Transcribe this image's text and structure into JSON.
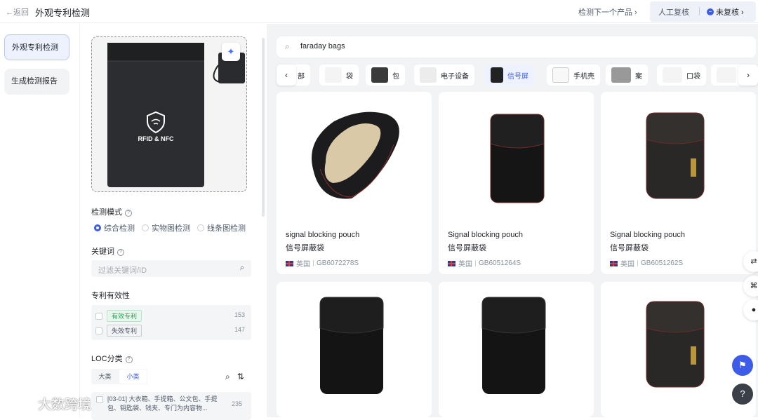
{
  "header": {
    "back_label": "←返回",
    "title": "外观专利检测",
    "next_product": "检测下一个产品 ›",
    "manual_review": "人工复核",
    "unreviewed": "未复核 ›"
  },
  "sidebar": {
    "items": [
      {
        "label": "外观专利检测",
        "active": true
      },
      {
        "label": "生成检测报告",
        "active": false
      }
    ]
  },
  "panel": {
    "image_text": "RFID & NFC",
    "mode_label": "检测模式",
    "modes": [
      "综合检测",
      "实物图检测",
      "线条图检测"
    ],
    "selected_mode": "综合检测",
    "keyword_label": "关键词",
    "keyword_placeholder": "过滤关键词/ID",
    "validity_label": "专利有效性",
    "validity": [
      {
        "label": "有效专利",
        "count": "153"
      },
      {
        "label": "失效专利",
        "count": "147"
      }
    ],
    "loc_label": "LOC分类",
    "loc_tabs": [
      "大类",
      "小类"
    ],
    "loc_selected_tab": "小类",
    "loc_items": [
      {
        "text": "[03-01] 大衣箱、手提箱、公文包、手提包、钥匙袋、钱夹、专门为内容物...",
        "count": "235"
      }
    ]
  },
  "main": {
    "search_value": "faraday bags",
    "categories": [
      {
        "label": "部",
        "selected": false
      },
      {
        "label": "袋",
        "selected": false
      },
      {
        "label": "包",
        "selected": false
      },
      {
        "label": "电子设备",
        "selected": false
      },
      {
        "label": "信号屏",
        "selected": true
      },
      {
        "label": "手机壳",
        "selected": false
      },
      {
        "label": "案",
        "selected": false
      },
      {
        "label": "口袋",
        "selected": false
      }
    ],
    "results": [
      {
        "title_en": "signal blocking pouch",
        "title_zh": "信号屏蔽袋",
        "country": "英国",
        "id": "GB6072278S"
      },
      {
        "title_en": "Signal blocking pouch",
        "title_zh": "信号屏蔽袋",
        "country": "英国",
        "id": "GB6051264S"
      },
      {
        "title_en": "Signal blocking pouch",
        "title_zh": "信号屏蔽袋",
        "country": "英国",
        "id": "GB6051262S"
      },
      {
        "title_en": "",
        "title_zh": "",
        "country": "",
        "id": ""
      },
      {
        "title_en": "",
        "title_zh": "",
        "country": "",
        "id": ""
      },
      {
        "title_en": "",
        "title_zh": "",
        "country": "",
        "id": ""
      }
    ]
  },
  "watermark": "大数跨境",
  "colors": {
    "accent": "#3d5ce8",
    "valid": "#22a45d"
  }
}
